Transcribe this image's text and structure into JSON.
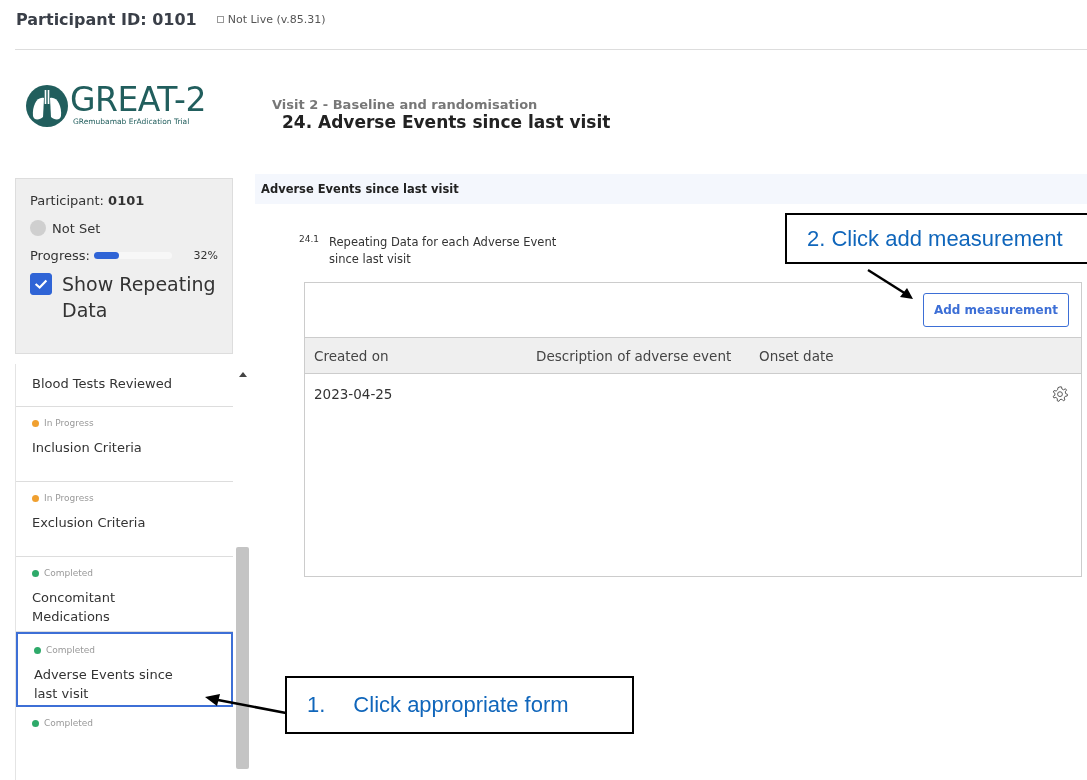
{
  "header": {
    "participant_id": "Participant ID: 0101",
    "environment": "Not Live (v.85.31)"
  },
  "logo": {
    "name": "GREAT-2",
    "tagline": "GRemubamab ErAdication Trial"
  },
  "participant_panel": {
    "participant": "Participant: **0101**",
    "status": "Not Set",
    "progress_label": "Progress:",
    "level": 0.32,
    "progress_value": "32%",
    "show_repeating": {
      "label": "Show Repeating Data",
      "checked": true
    }
  },
  "form_list": [
    {
      "label": "Blood Tests Reviewed",
      "selected": false
    },
    {
      "status": "In Progress",
      "color": "#f0a030",
      "label": "Inclusion Criteria",
      "selected": false
    },
    {
      "status": "In Progress",
      "color": "#f0a030",
      "label": "Exclusion Criteria",
      "selected": false
    },
    {
      "status": "Completed",
      "color": "#2eaa6a",
      "label": "Concomitant Medications",
      "selected": false
    },
    {
      "status": "Completed",
      "color": "#2eaa6a",
      "label": "Adverse Events since last visit",
      "selected": true
    },
    {
      "status": "Completed",
      "color": "#2eaa6a",
      "selected": false
    }
  ],
  "visit": "Visit 2 - Baseline and randomisation",
  "form_title": "24. Adverse Events since last visit",
  "section": "Adverse Events since last visit",
  "question": {
    "number": "24.1",
    "text": "Repeating Data for each Adverse Event since last visit"
  },
  "add_button": "Add measurement",
  "table": {
    "columns": [
      "Created on",
      "Description of adverse event",
      "Onset date"
    ],
    "rows": [
      [
        "2023-04-25",
        "",
        ""
      ]
    ]
  },
  "annotations": [
    {
      "text": "2. Click add measurement"
    },
    {
      "number": "1.",
      "text": "Click appropriate form"
    }
  ]
}
